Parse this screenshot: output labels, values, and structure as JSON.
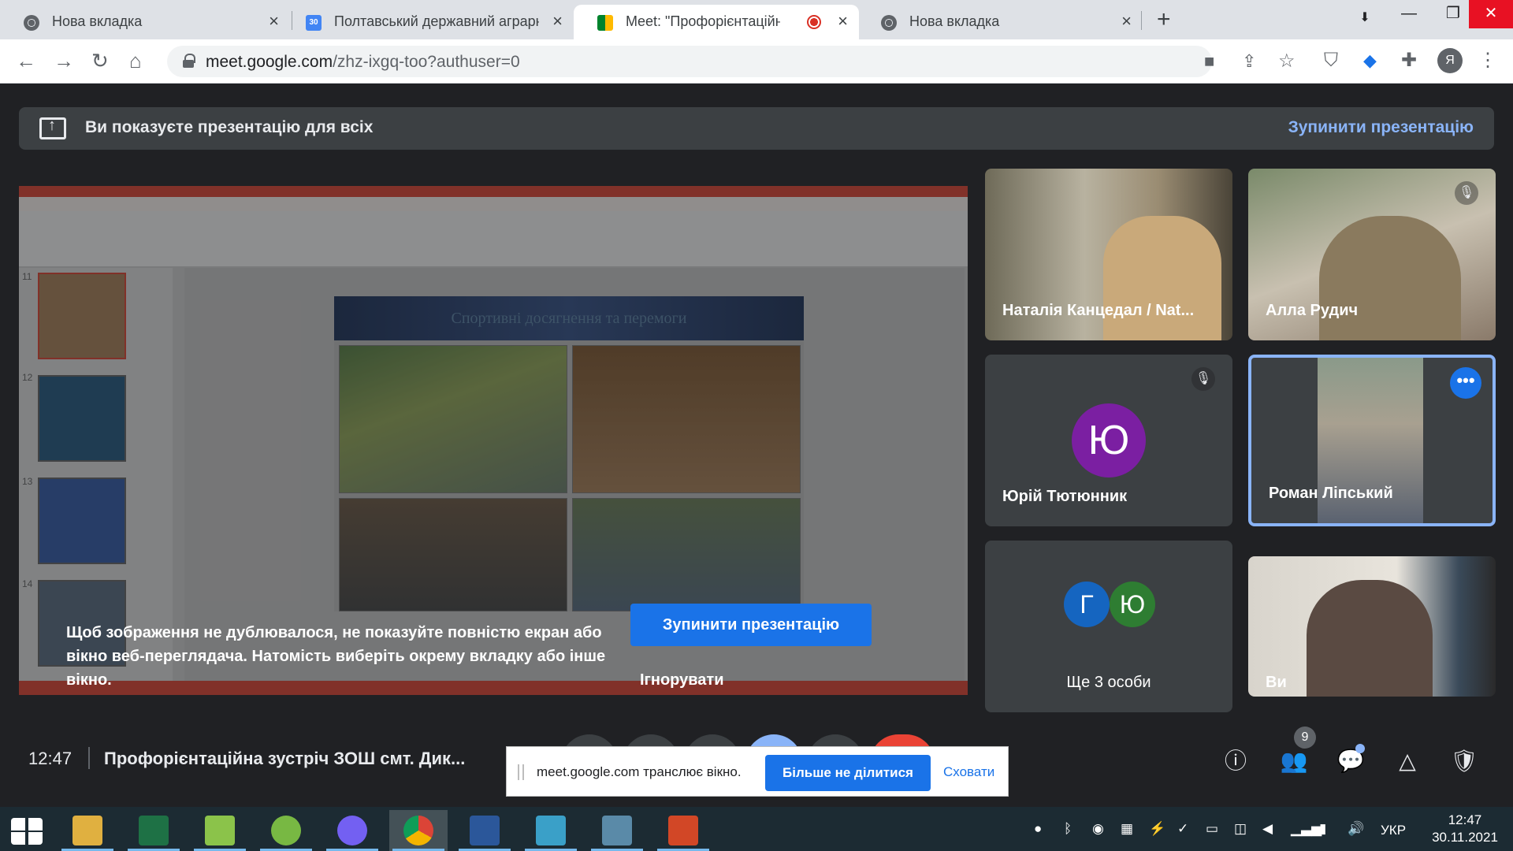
{
  "browser": {
    "tabs": [
      {
        "title": "Нова вкладка",
        "icon": "chrome-icon",
        "active": false
      },
      {
        "title": "Полтавський державний аграрн",
        "icon": "calendar-icon",
        "active": false,
        "favicon_text": "30"
      },
      {
        "title": "Meet: \"Профорієнтаційна зу",
        "icon": "meet-icon",
        "active": true
      },
      {
        "title": "Нова вкладка",
        "icon": "chrome-icon",
        "active": false
      }
    ],
    "url_host": "meet.google.com",
    "url_path": "/zhz-ixgq-too?authuser=0",
    "profile_initial": "Я"
  },
  "banner": {
    "text": "Ви показуєте презентацію для всіх",
    "stop_label": "Зупинити презентацію"
  },
  "presentation": {
    "slide_title": "Спортивні досягнення та перемоги",
    "slide_numbers": [
      "11",
      "12",
      "13",
      "14"
    ],
    "warning": "Щоб зображення не дублювалося, не показуйте повністю екран або вікно веб-переглядача. Натомість виберіть окрему вкладку або інше вікно.",
    "stop_button": "Зупинити презентацію",
    "ignore_button": "Ігнорувати"
  },
  "participants": [
    {
      "name": "Наталія Канцедал / Nat...",
      "muted": false
    },
    {
      "name": "Алла Рудич",
      "muted": true
    },
    {
      "name": "Юрій Тютюнник",
      "initial": "Ю",
      "muted": true,
      "avatar_color": "#7b1fa2"
    },
    {
      "name": "Роман Ліпський",
      "muted": false,
      "speaking": true
    },
    {
      "name": "Ще 3 особи",
      "initials": [
        "Г",
        "Ю"
      ],
      "avatar_colors": [
        "#1565c0",
        "#2e7d32"
      ]
    },
    {
      "name": "Ви"
    }
  ],
  "meeting": {
    "time": "12:47",
    "title": "Профорієнтаційна зустріч ЗОШ смт. Дик...",
    "people_count": "9"
  },
  "share_notice": {
    "text": "meet.google.com транслює вікно.",
    "stop_label": "Більше не ділитися",
    "hide_label": "Сховати"
  },
  "taskbar": {
    "language": "УКР",
    "time": "12:47",
    "date": "30.11.2021",
    "apps": [
      "file-explorer-icon",
      "excel-icon",
      "notepad-icon",
      "utorrent-icon",
      "viber-icon",
      "chrome-icon",
      "word-icon",
      "photos-icon",
      "screen-icon",
      "powerpoint-icon"
    ]
  },
  "colors": {
    "meet_bg": "#202124",
    "accent_blue": "#1a73e8",
    "link_blue": "#8ab4f8",
    "end_call_red": "#ea4335"
  }
}
